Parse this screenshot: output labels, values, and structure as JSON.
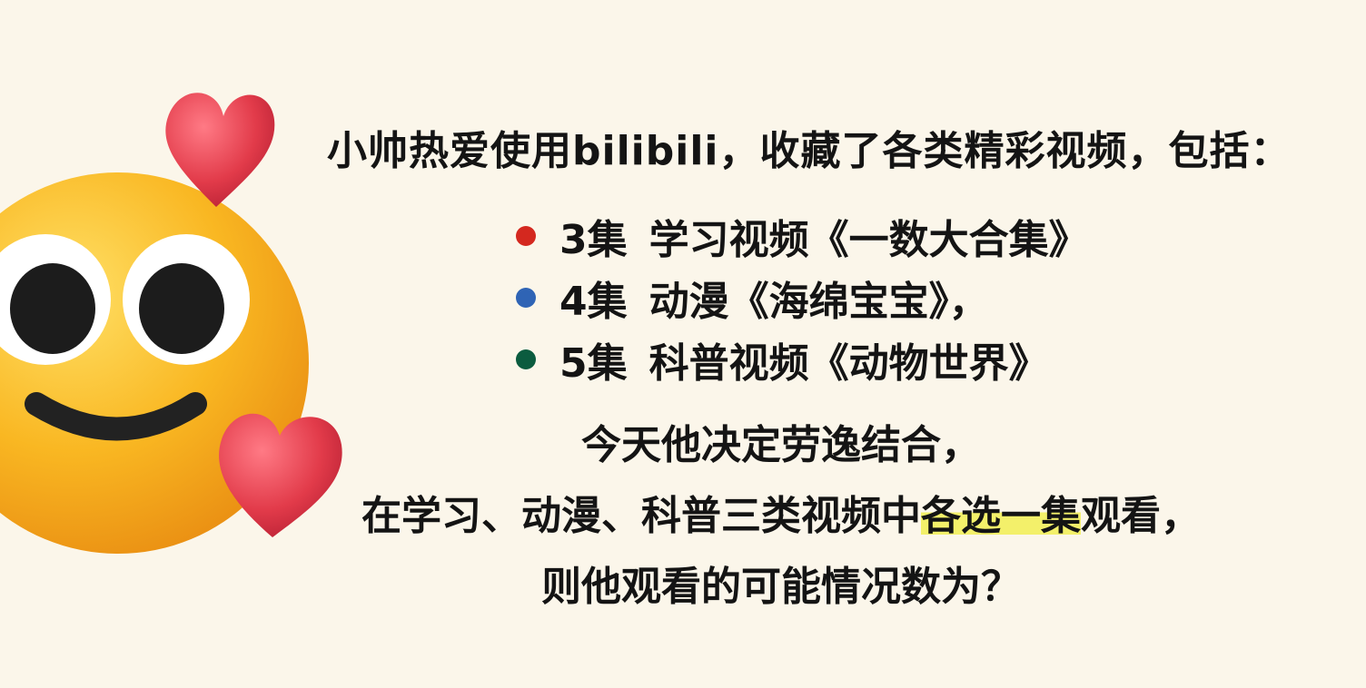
{
  "headline": "小帅热爱使用bilibili，收藏了各类精彩视频，包括：",
  "series": [
    {
      "count": "3集",
      "title": "学习视频《一数大合集》",
      "dot_color": "#d4281f"
    },
    {
      "count": "4集",
      "title": "动漫《海绵宝宝》，",
      "dot_color": "#2f64b5"
    },
    {
      "count": "5集",
      "title": "科普视频《动物世界》",
      "dot_color": "#0b5c3f"
    }
  ],
  "question": {
    "line1": "今天他决定劳逸结合，",
    "line2_before": "在学习、动漫、科普三类视频中",
    "line2_highlight": "各选一集",
    "line2_after": "观看，",
    "line3": "则他观看的可能情况数为？"
  },
  "colors": {
    "background": "#fbf6ea",
    "highlight": "#f3f06a",
    "emoji_face": "#f8b51f",
    "heart": "#e23b4a"
  },
  "icons": [
    "smiling-face-with-hearts-icon",
    "heart-icon"
  ]
}
